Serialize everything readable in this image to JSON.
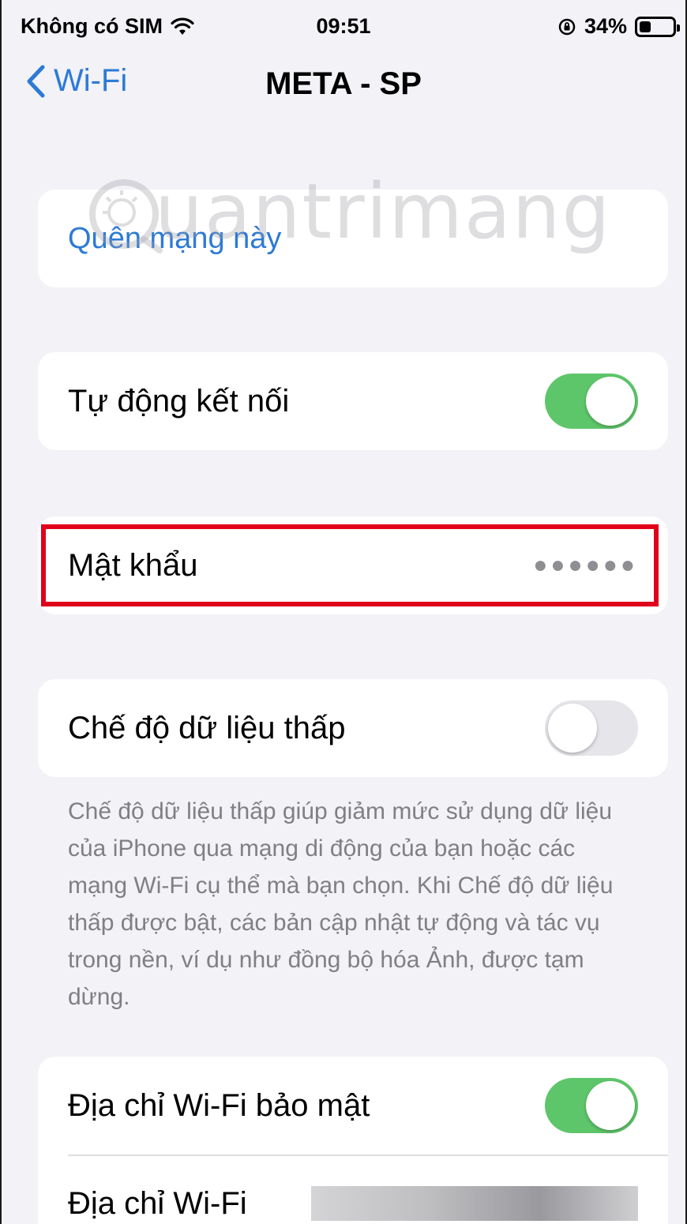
{
  "status_bar": {
    "carrier": "Không có SIM",
    "time": "09:51",
    "battery_percent": "34%",
    "battery_level": 0.34
  },
  "nav": {
    "back_label": "Wi-Fi",
    "title": "META - SP"
  },
  "forget": {
    "label": "Quên mạng này"
  },
  "auto_join": {
    "label": "Tự động kết nối",
    "on": true
  },
  "password": {
    "label": "Mật khẩu",
    "masked_value": "●●●●●●"
  },
  "low_data": {
    "label": "Chế độ dữ liệu thấp",
    "on": false,
    "description": "Chế độ dữ liệu thấp giúp giảm mức sử dụng dữ liệu của iPhone qua mạng di động của bạn hoặc các mạng Wi-Fi cụ thể mà bạn chọn. Khi Chế độ dữ liệu thấp được bật, các bản cập nhật tự động và tác vụ trong nền, ví dụ như đồng bộ hóa Ảnh, được tạm dừng."
  },
  "private_address": {
    "label": "Địa chỉ Wi-Fi bảo mật",
    "on": true
  },
  "wifi_address": {
    "label": "Địa chỉ Wi-Fi"
  },
  "watermark": {
    "text": "uantrimang"
  },
  "colors": {
    "accent_blue": "#2d7ad6",
    "toggle_green": "#5ec66a",
    "highlight_red": "#e0001b"
  }
}
